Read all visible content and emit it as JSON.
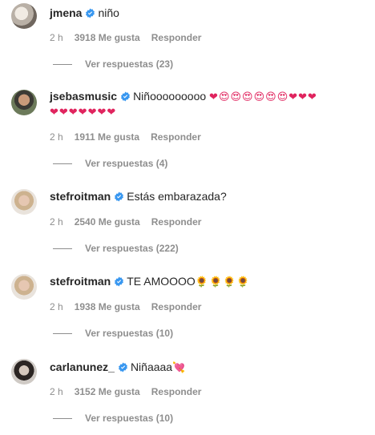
{
  "comments": [
    {
      "username": "jmena",
      "text": "niño",
      "emojis": "",
      "time": "2 h",
      "likes": "3918 Me gusta",
      "reply": "Responder",
      "view_replies": "Ver respuestas (23)"
    },
    {
      "username": "jsebasmusic",
      "text": "Niñooooooooo",
      "emojis": "❤😍😍😍😍😍😍❤❤❤",
      "emojis2": "❤❤❤❤❤❤❤",
      "time": "2 h",
      "likes": "1911 Me gusta",
      "reply": "Responder",
      "view_replies": "Ver respuestas (4)"
    },
    {
      "username": "stefroitman",
      "text": "Estás embarazada?",
      "emojis": "",
      "time": "2 h",
      "likes": "2540 Me gusta",
      "reply": "Responder",
      "view_replies": "Ver respuestas (222)"
    },
    {
      "username": "stefroitman",
      "text": "TE AMOOOO",
      "emojis": "🌻🌻🌻🌻",
      "time": "2 h",
      "likes": "1938 Me gusta",
      "reply": "Responder",
      "view_replies": "Ver respuestas (10)"
    },
    {
      "username": "carlanunez_",
      "text": "Niñaaaa",
      "emojis": "💘",
      "time": "2 h",
      "likes": "3152 Me gusta",
      "reply": "Responder",
      "view_replies": "Ver respuestas (10)"
    }
  ],
  "colors": {
    "verified": "#3897f0",
    "meta": "#8e8e8e",
    "text": "#262626"
  }
}
